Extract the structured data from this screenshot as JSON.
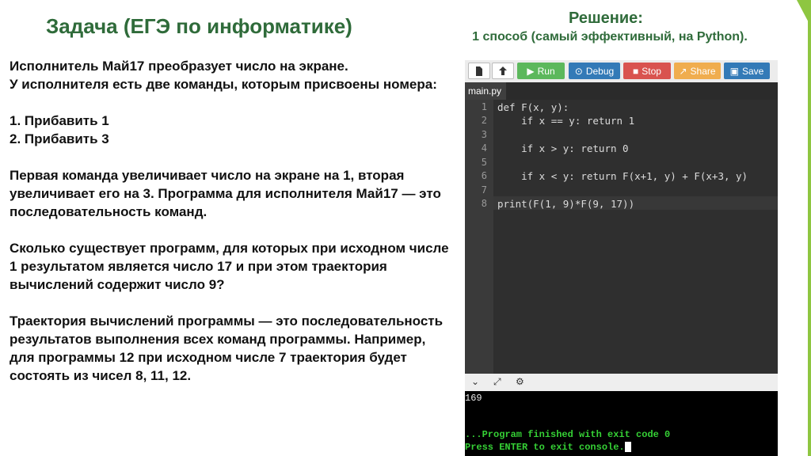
{
  "slide": {
    "title": "Задача (ЕГЭ по информатике)",
    "solution_title": "Решение:",
    "solution_subtitle": "1 способ (самый эффективный, на Python).",
    "task_paragraphs": [
      "Исполнитель Май17 преобразует число на экране.",
      "У исполнителя есть две команды, которым присвоены номера:",
      "",
      "1. Прибавить 1",
      "2. Прибавить 3",
      "",
      "Первая команда увеличивает число на экране на 1, вторая увеличивает его на 3. Программа для исполнителя Май17 — это последовательность команд.",
      "",
      "Сколько существует программ, для которых при исходном числе 1 результатом является число 17 и при этом траектория вычислений содержит число 9?",
      "",
      "Траектория вычислений программы — это последовательность результатов выполнения всех команд программы. Например, для программы 12 при исходном числе 7 траектория будет состоять из чисел 8, 11, 12."
    ]
  },
  "ide": {
    "toolbar": {
      "new_icon": "file-icon",
      "upload_icon": "upload-icon",
      "run": "Run",
      "debug": "Debug",
      "stop": "Stop",
      "share": "Share",
      "save": "Save"
    },
    "tab": "main.py",
    "line_numbers": [
      "1",
      "2",
      "3",
      "4",
      "5",
      "6",
      "7",
      "8"
    ],
    "code": [
      "def F(x, y):",
      "    if x == y: return 1",
      "",
      "    if x > y: return 0",
      "",
      "    if x < y: return F(x+1, y) + F(x+3, y)",
      "",
      "print(F(1, 9)*F(9, 17))"
    ],
    "console": {
      "output": "169",
      "finished": "...Program finished with exit code 0",
      "prompt": "Press ENTER to exit console."
    }
  },
  "colors": {
    "accent_green": "#8ec641",
    "title_green": "#2f6b3a"
  }
}
